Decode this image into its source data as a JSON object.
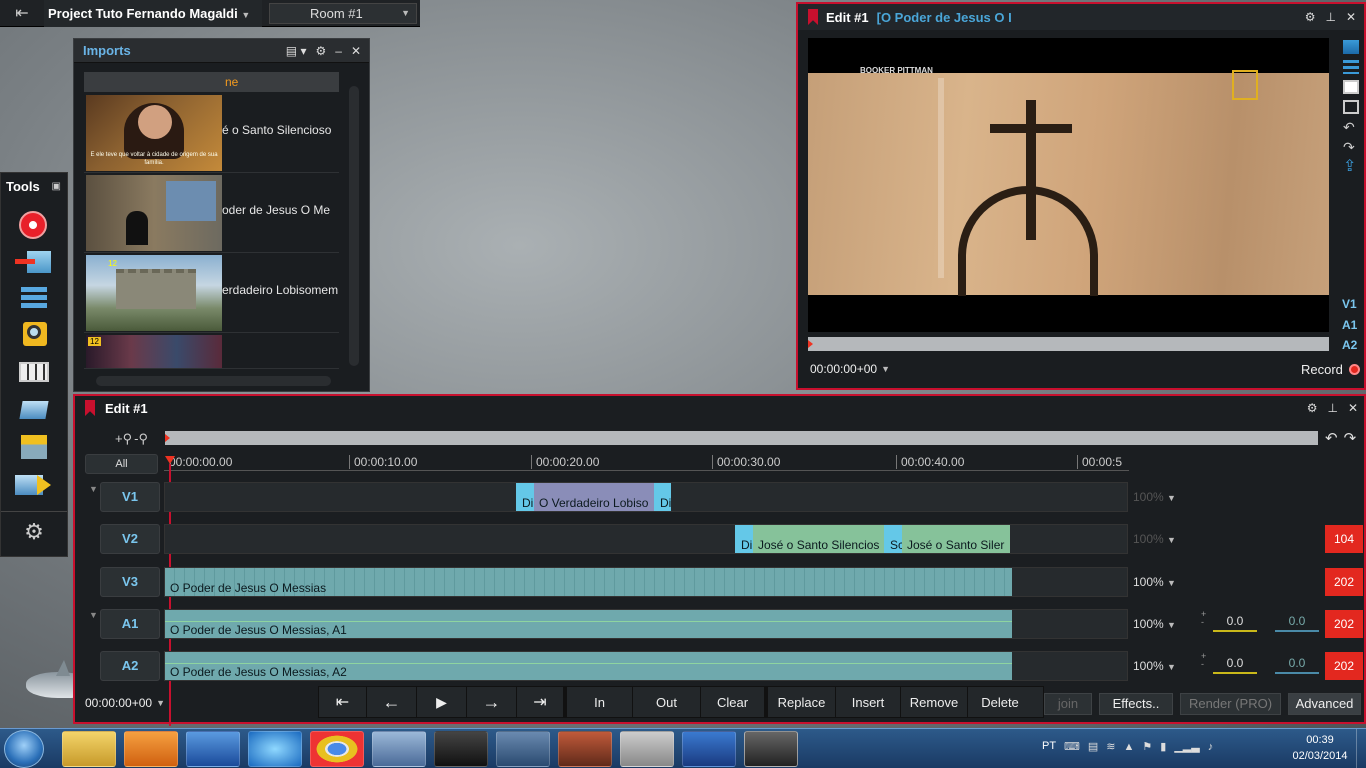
{
  "topbar": {
    "back_icon": "exit-icon",
    "project_title": "Project Tuto Fernando Magaldi",
    "room": "Room #1"
  },
  "imports": {
    "title": "Imports",
    "column_header": "ne",
    "items": [
      {
        "label": "é o Santo Silencioso",
        "caption": "E ele teve que voltar à cidade de origem de sua família."
      },
      {
        "label": "oder de Jesus   O Me"
      },
      {
        "label": "erdadeiro Lobisomem",
        "badge": "12"
      },
      {
        "label": "",
        "badge": "12"
      }
    ]
  },
  "tools": {
    "title": "Tools",
    "items": [
      "record-icon",
      "capture-icon",
      "timeline-icon",
      "search-icon",
      "grid-icon",
      "layers-icon",
      "export-icon",
      "send-icon",
      "settings-icon"
    ]
  },
  "viewer": {
    "title": "Edit #1",
    "subtitle": "[O Poder de Jesus   O I",
    "video_caption": "BOOKER PITTMAN",
    "timecode": "00:00:00+00",
    "record_label": "Record",
    "track_labels": [
      "V1",
      "A1",
      "A2"
    ]
  },
  "edit": {
    "title": "Edit #1",
    "all_label": "All",
    "ruler": [
      "00:00:00.00",
      "00:00:10.00",
      "00:00:20.00",
      "00:00:30.00",
      "00:00:40.00",
      "00:00:5"
    ],
    "timecode": "00:00:00+00",
    "tracks": [
      {
        "name": "V1",
        "pct": "100%",
        "clips": [
          "Di",
          "O Verdadeiro Lobiso",
          "Di"
        ]
      },
      {
        "name": "V2",
        "pct": "100%",
        "clips": [
          "Di",
          "José o Santo Silencios",
          "Sc",
          "José o Santo Siler"
        ],
        "badge": "104"
      },
      {
        "name": "V3",
        "pct": "100%",
        "clips": [
          "O Poder de Jesus   O Messias"
        ],
        "badge": "202"
      },
      {
        "name": "A1",
        "pct": "100%",
        "clips": [
          "O Poder de Jesus   O Messias, A1"
        ],
        "val1": "0.0",
        "val2": "0.0",
        "badge": "202"
      },
      {
        "name": "A2",
        "pct": "100%",
        "clips": [
          "O Poder de Jesus   O Messias, A2"
        ],
        "val1": "0.0",
        "val2": "0.0",
        "badge": "202"
      }
    ],
    "transport": {
      "in": "In",
      "out": "Out",
      "clear": "Clear",
      "replace": "Replace",
      "insert": "Insert",
      "remove": "Remove",
      "delete": "Delete"
    },
    "buttons": {
      "join": "join",
      "effects": "Effects..",
      "render": "Render (PRO)",
      "advanced": "Advanced"
    }
  },
  "taskbar": {
    "lang": "PT",
    "time": "00:39",
    "date": "02/03/2014"
  },
  "colors": {
    "accent": "#c8102e",
    "title_blue": "#4aa6d8",
    "badge_red": "#e3281f",
    "clip_teal": "#6fa9ad",
    "clip_green": "#86c29a",
    "clip_purple": "#8a8db8"
  }
}
